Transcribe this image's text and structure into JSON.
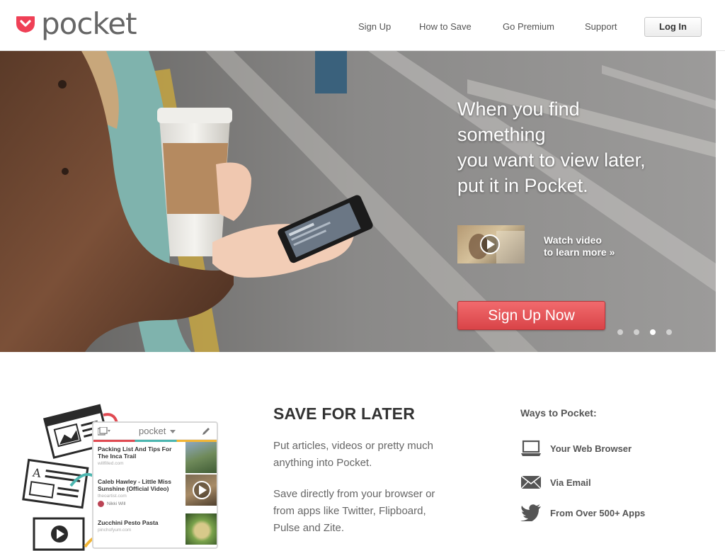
{
  "header": {
    "brand": "pocket",
    "nav": [
      {
        "label": "Sign Up"
      },
      {
        "label": "How to Save"
      },
      {
        "label": "Go Premium"
      },
      {
        "label": "Support"
      }
    ],
    "login_label": "Log In"
  },
  "hero": {
    "headline_lines": [
      "When you find",
      "something",
      "you want to view later,",
      "put it in Pocket."
    ],
    "video_link_lines": [
      "Watch video",
      "to learn more »"
    ],
    "cta_label": "Sign Up Now",
    "carousel_active_index": 2,
    "carousel_count": 4
  },
  "features": {
    "illustration": {
      "app_logo": "pocket",
      "items": [
        {
          "title": "Packing List And Tips For The Inca Trail",
          "source": "willfilled.com"
        },
        {
          "title": "Caleb Hawley - Little Miss Sunshine (Official Video)",
          "source": "theoartist.com",
          "author": "Nikki Will"
        },
        {
          "title": "Zucchini Pesto Pasta",
          "source": "pinchofyum.com"
        }
      ]
    },
    "title": "SAVE FOR LATER",
    "para1_lines": [
      "Put articles, videos or pretty much",
      "anything into Pocket."
    ],
    "para2_lines": [
      "Save directly from your browser or",
      "from apps like Twitter, Flipboard,",
      "Pulse and Zite."
    ]
  },
  "ways": {
    "title": "Ways to Pocket:",
    "items": [
      {
        "label": "Your Web Browser",
        "icon": "laptop-icon"
      },
      {
        "label": "Via Email",
        "icon": "envelope-icon"
      },
      {
        "label": "From Over 500+ Apps",
        "icon": "twitter-bird-icon"
      }
    ]
  },
  "colors": {
    "brand_red": "#ef4056",
    "cta_red": "#e0534f",
    "text_dark": "#333333",
    "text_grey": "#666666"
  }
}
